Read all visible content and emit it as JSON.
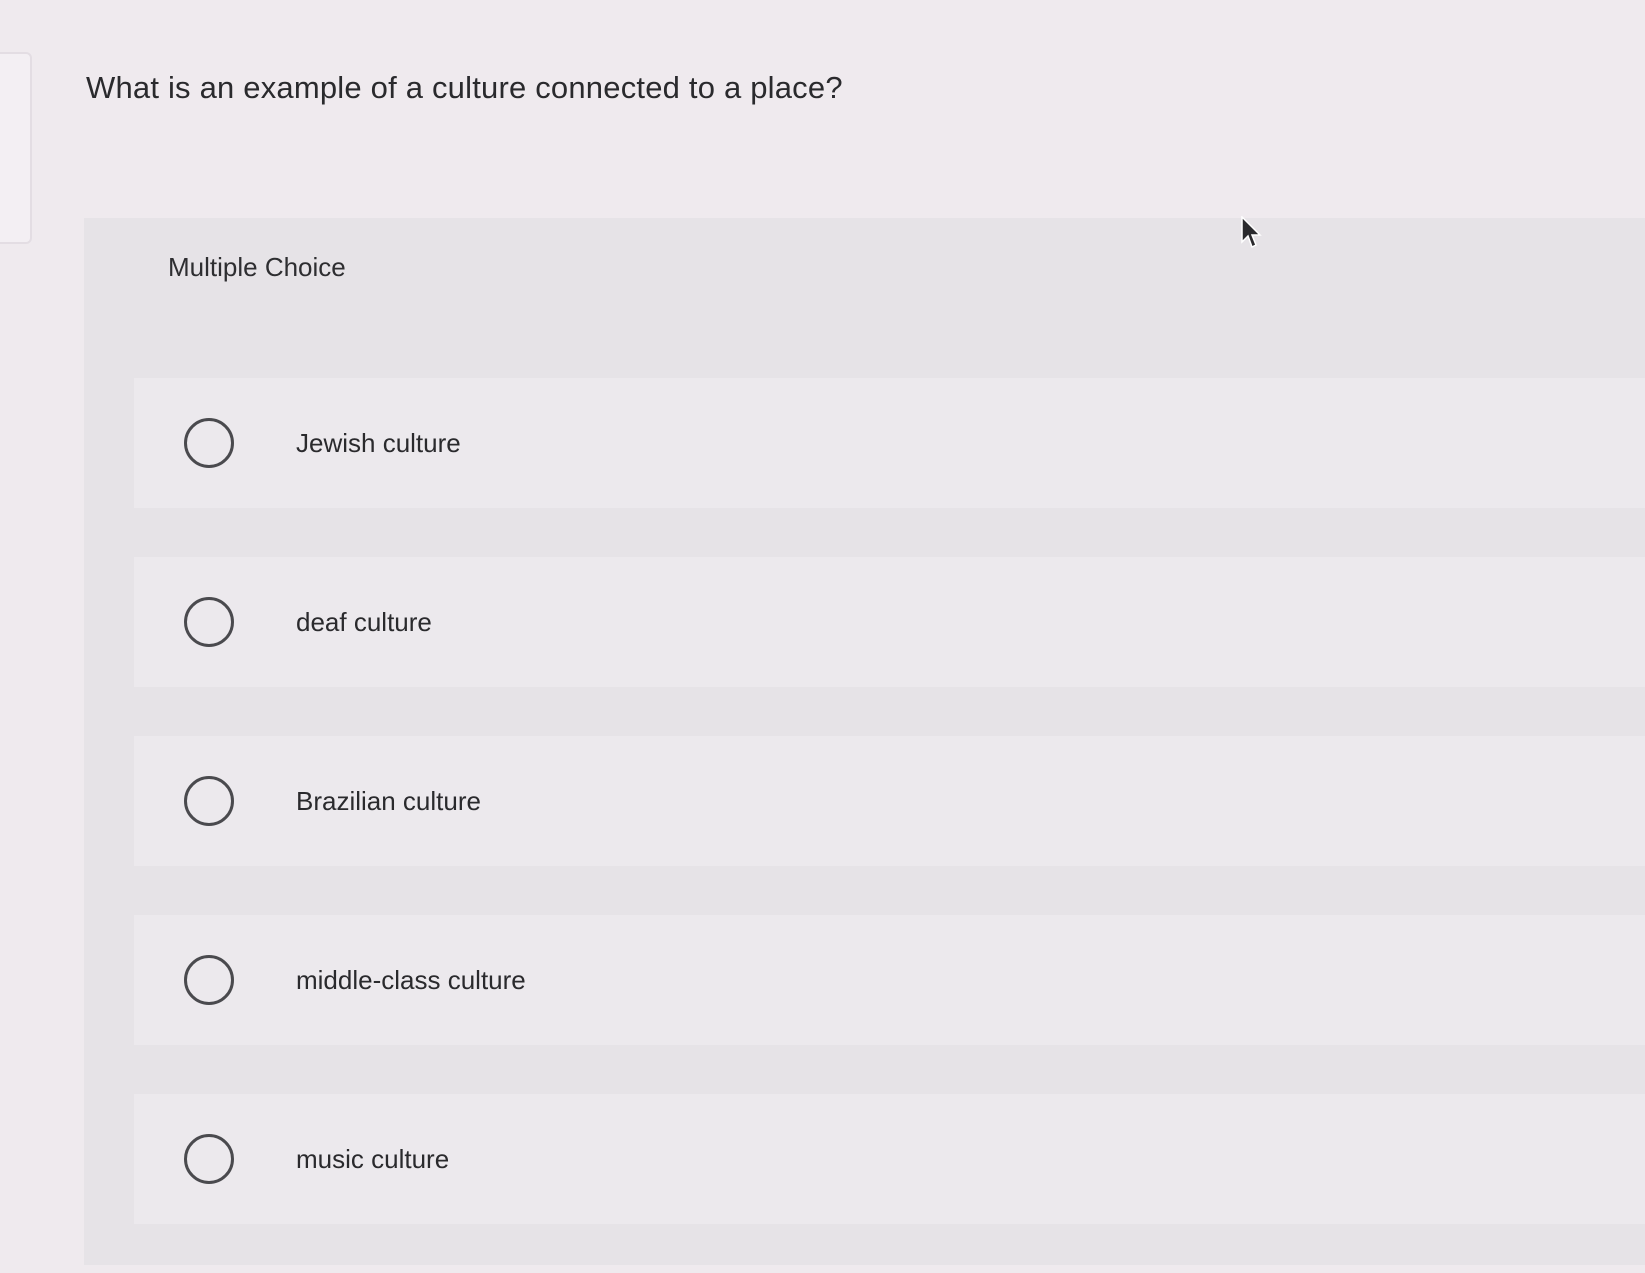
{
  "question": {
    "text": "What is an example of a culture connected to a place?"
  },
  "panel": {
    "type_label": "Multiple Choice"
  },
  "options": [
    {
      "label": "Jewish culture",
      "selected": false
    },
    {
      "label": "deaf culture",
      "selected": false
    },
    {
      "label": "Brazilian culture",
      "selected": false
    },
    {
      "label": "middle-class culture",
      "selected": false
    },
    {
      "label": "music culture",
      "selected": false
    }
  ],
  "icons": {
    "cursor": "mouse-pointer-icon",
    "radio": "radio-circle-icon"
  }
}
